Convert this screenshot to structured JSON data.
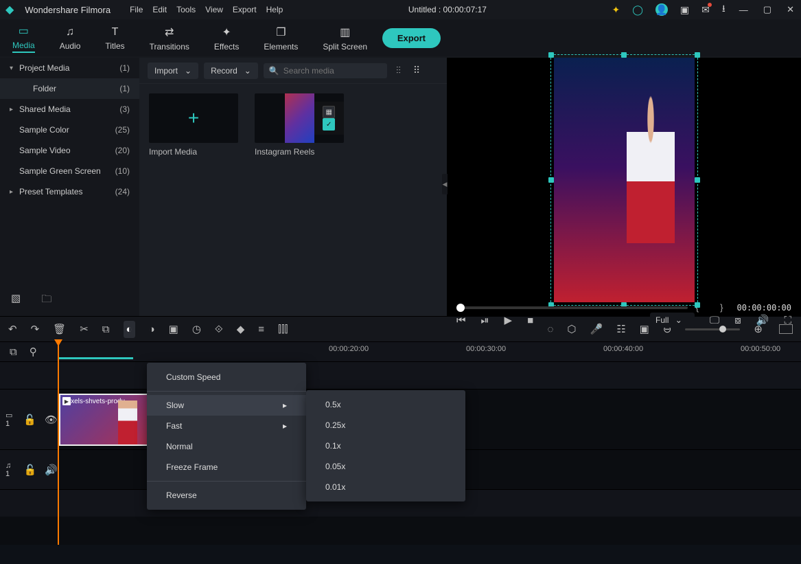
{
  "app_name": "Wondershare Filmora",
  "menus": [
    "File",
    "Edit",
    "Tools",
    "View",
    "Export",
    "Help"
  ],
  "document_title": "Untitled : 00:00:07:17",
  "tabs": [
    {
      "label": "Media",
      "icon": "▭"
    },
    {
      "label": "Audio",
      "icon": "♫"
    },
    {
      "label": "Titles",
      "icon": "T"
    },
    {
      "label": "Transitions",
      "icon": "⇄"
    },
    {
      "label": "Effects",
      "icon": "✦"
    },
    {
      "label": "Elements",
      "icon": "❐"
    },
    {
      "label": "Split Screen",
      "icon": "▥"
    }
  ],
  "export_label": "Export",
  "sidebar": {
    "items": [
      {
        "label": "Project Media",
        "count": "(1)",
        "caret": "▾",
        "sub": false,
        "selected": false
      },
      {
        "label": "Folder",
        "count": "(1)",
        "caret": "",
        "sub": true,
        "selected": true
      },
      {
        "label": "Shared Media",
        "count": "(3)",
        "caret": "▸",
        "sub": false,
        "selected": false
      },
      {
        "label": "Sample Color",
        "count": "(25)",
        "caret": "",
        "sub": false,
        "selected": false
      },
      {
        "label": "Sample Video",
        "count": "(20)",
        "caret": "",
        "sub": false,
        "selected": false
      },
      {
        "label": "Sample Green Screen",
        "count": "(10)",
        "caret": "",
        "sub": false,
        "selected": false
      },
      {
        "label": "Preset Templates",
        "count": "(24)",
        "caret": "▸",
        "sub": false,
        "selected": false
      }
    ]
  },
  "media_toolbar": {
    "import": "Import",
    "record": "Record",
    "search_placeholder": "Search media"
  },
  "media_cards": {
    "import_caption": "Import Media",
    "reel_caption": "Instagram Reels"
  },
  "preview": {
    "timecode": "00:00:00:00",
    "quality": "Full"
  },
  "ruler_marks": [
    "00:00:20:00",
    "00:00:30:00",
    "00:00:40:00",
    "00:00:50:00"
  ],
  "tracks": {
    "video": "▭ 1",
    "audio": "♫ 1"
  },
  "clip_label": "pexels-shvets-produ",
  "speed_menu": {
    "items": [
      "Custom Speed",
      "Slow",
      "Fast",
      "Normal",
      "Freeze Frame",
      "Reverse"
    ],
    "slow_options": [
      "0.5x",
      "0.25x",
      "0.1x",
      "0.05x",
      "0.01x"
    ]
  }
}
